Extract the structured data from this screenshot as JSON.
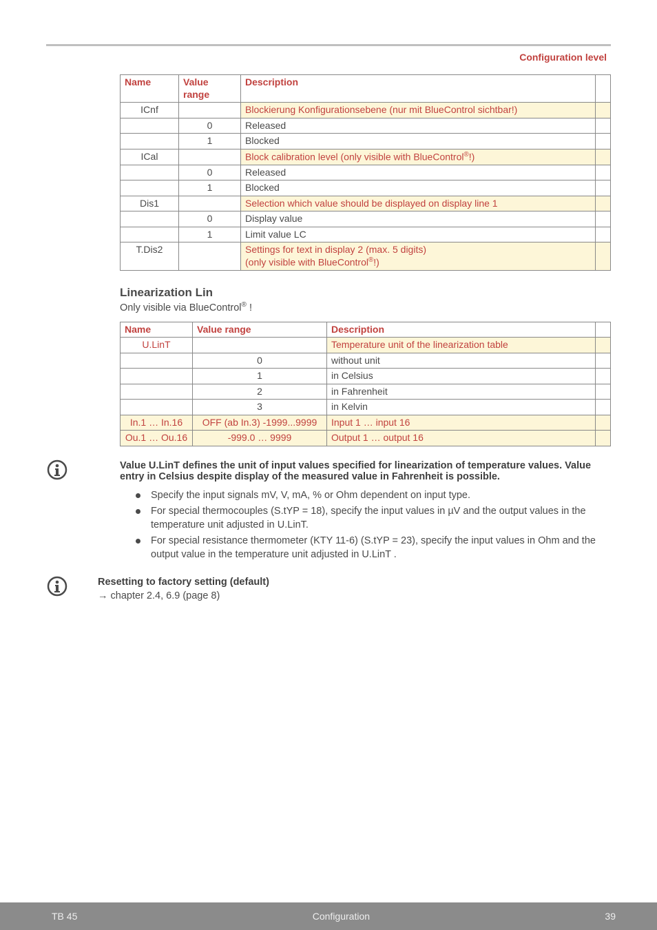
{
  "header": {
    "section": "Configuration level"
  },
  "table1": {
    "headers": {
      "name": "Name",
      "value_range": "Value range",
      "description": "Description"
    },
    "rows": [
      {
        "name": "ICnf",
        "vr": "",
        "desc": "Blockierung Konfigurationsebene     (nur mit BlueControl sichtbar!)",
        "hl": true
      },
      {
        "name": "",
        "vr": "0",
        "desc": "Released",
        "hl": false
      },
      {
        "name": "",
        "vr": "1",
        "desc": "Blocked",
        "hl": false
      },
      {
        "name": "ICal",
        "vr": "",
        "desc": "Block calibration level  (only visible with BlueControl®!)",
        "hl": true
      },
      {
        "name": "",
        "vr": "0",
        "desc": "Released",
        "hl": false
      },
      {
        "name": "",
        "vr": "1",
        "desc": "Blocked",
        "hl": false
      },
      {
        "name": "Dis1",
        "vr": "",
        "desc": "Selection which value should be displayed on display line 1",
        "hl": true
      },
      {
        "name": "",
        "vr": "0",
        "desc": "Display value",
        "hl": false
      },
      {
        "name": "",
        "vr": "1",
        "desc": "Limit value LC",
        "hl": false
      },
      {
        "name": "T.Dis2",
        "vr": "",
        "desc": "Settings for text in display 2  (max. 5 digits)\n(only visible with BlueControl®!)",
        "hl": true
      }
    ]
  },
  "lin_section": {
    "title": "Linearization Lin",
    "subtitle_pre": "Only visible via BlueControl",
    "subtitle_post": " !"
  },
  "table2": {
    "headers": {
      "name": "Name",
      "value_range": "Value range",
      "description": "Description"
    },
    "rows": [
      {
        "name": "U.LinT",
        "vr": "",
        "desc": "Temperature unit of the linearization table",
        "hl": true
      },
      {
        "name": "",
        "vr": "0",
        "desc": "without unit",
        "hl": false
      },
      {
        "name": "",
        "vr": "1",
        "desc": "in Celsius",
        "hl": false
      },
      {
        "name": "",
        "vr": "2",
        "desc": "in Fahrenheit",
        "hl": false
      },
      {
        "name": "",
        "vr": "3",
        "desc": "in Kelvin",
        "hl": false
      },
      {
        "name": "In.1  … In.16",
        "vr": "OFF (ab In.3) -1999...9999",
        "desc": "Input 1 … input 16",
        "hl": true
      },
      {
        "name": "Ou.1 … Ou.16",
        "vr": "-999.0 … 9999",
        "desc": "Output 1 … output 16",
        "hl": true
      }
    ]
  },
  "info1": "Value U.LinT defines the unit of input values specified for linearization of temperature values. Value entry in Celsius despite display of the measured value in Fahrenheit is possible.",
  "bullets": [
    "Specify the input signals mV, V, mA, % or Ohm dependent on input type.",
    "For special thermocouples (S.tYP = 18), specify the input values in µV and the output values in the temperature unit adjusted in U.LinT.",
    "For special resistance thermometer (KTY 11-6) (S.tYP = 23), specify the input values in Ohm and the output value in the temperature unit adjusted in U.LinT ."
  ],
  "reset": {
    "title": "Resetting to factory setting (default)",
    "ref": "→  chapter  2.4, 6.9  (page 8)"
  },
  "footer": {
    "left": "TB 45",
    "center": "Configuration",
    "right": "39"
  }
}
